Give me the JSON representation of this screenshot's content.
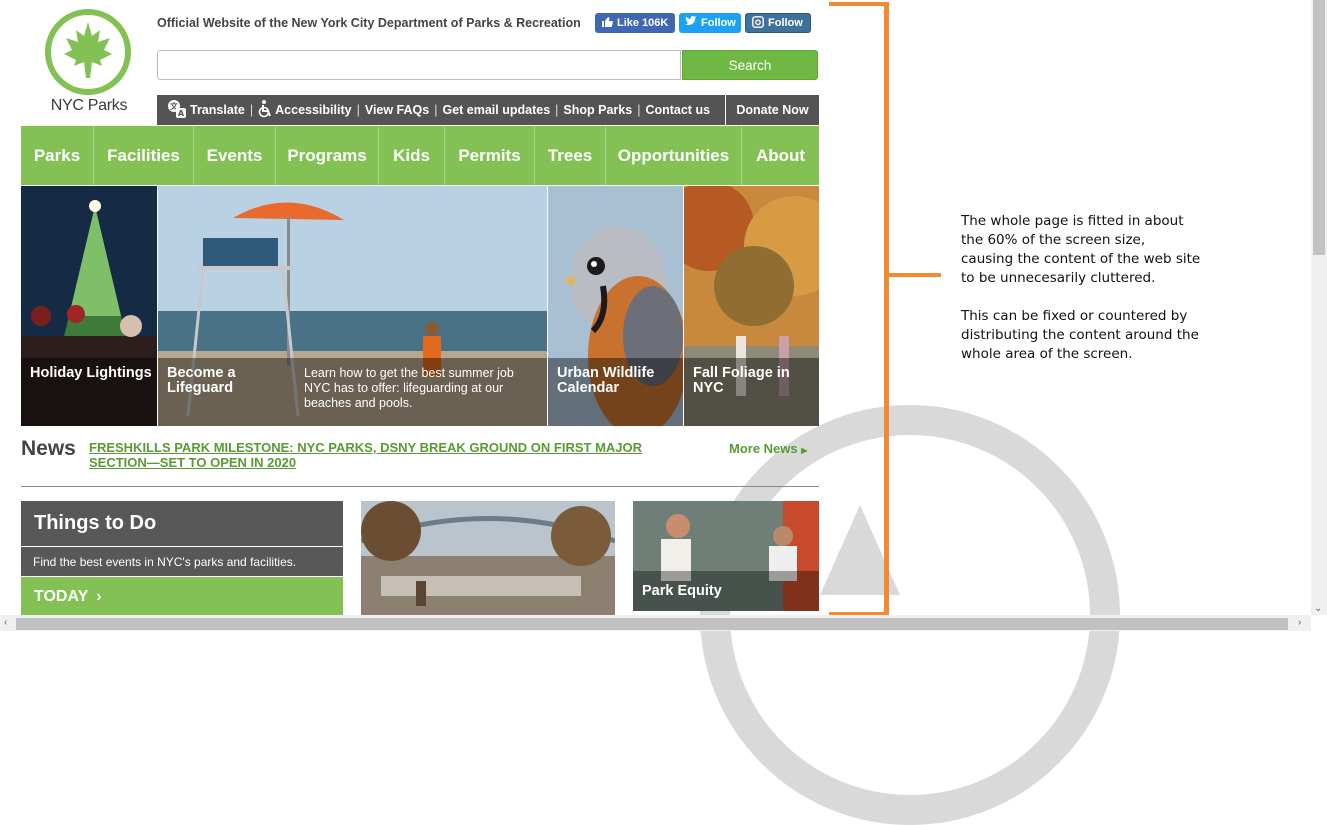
{
  "header": {
    "logo_text": "NYC Parks",
    "official_text": "Official Website of the New York City Department of Parks & Recreation",
    "social": {
      "facebook": "Like 106K",
      "twitter": "Follow",
      "instagram": "Follow"
    },
    "search": {
      "placeholder": "",
      "button": "Search"
    },
    "utility": [
      "Translate",
      "Accessibility",
      "View FAQs",
      "Get email updates",
      "Shop Parks",
      "Contact us"
    ],
    "donate": "Donate Now"
  },
  "nav": [
    "Parks",
    "Facilities",
    "Events",
    "Programs",
    "Kids",
    "Permits",
    "Trees",
    "Opportunities",
    "About"
  ],
  "tiles": [
    {
      "title": "Holiday Lightings"
    },
    {
      "title": "Become a Lifeguard",
      "desc": "Learn how to get the best summer job NYC has to offer: lifeguarding at our beaches and pools."
    },
    {
      "title": "Urban Wildlife Calendar"
    },
    {
      "title": "Fall Foliage in NYC"
    }
  ],
  "news": {
    "label": "News",
    "headline": "FRESHKILLS PARK MILESTONE: NYC PARKS, DSNY BREAK GROUND ON FIRST MAJOR SECTION—SET TO OPEN IN 2020",
    "more": "More News"
  },
  "things_to_do": {
    "title": "Things to Do",
    "subtitle": "Find the best events in NYC's parks and facilities.",
    "today": "TODAY"
  },
  "park_equity": "Park Equity",
  "annotation": {
    "p1": "The whole page is fitted in about the 60% of the screen size, causing the content of the web site to be unnecesarily cluttered.",
    "p2": "This can be fixed or countered by distributing the content around the whole area of the screen."
  },
  "colors": {
    "green": "#84c155",
    "dark": "#545454",
    "orange": "#f28a31",
    "link_green": "#5a9a35"
  }
}
